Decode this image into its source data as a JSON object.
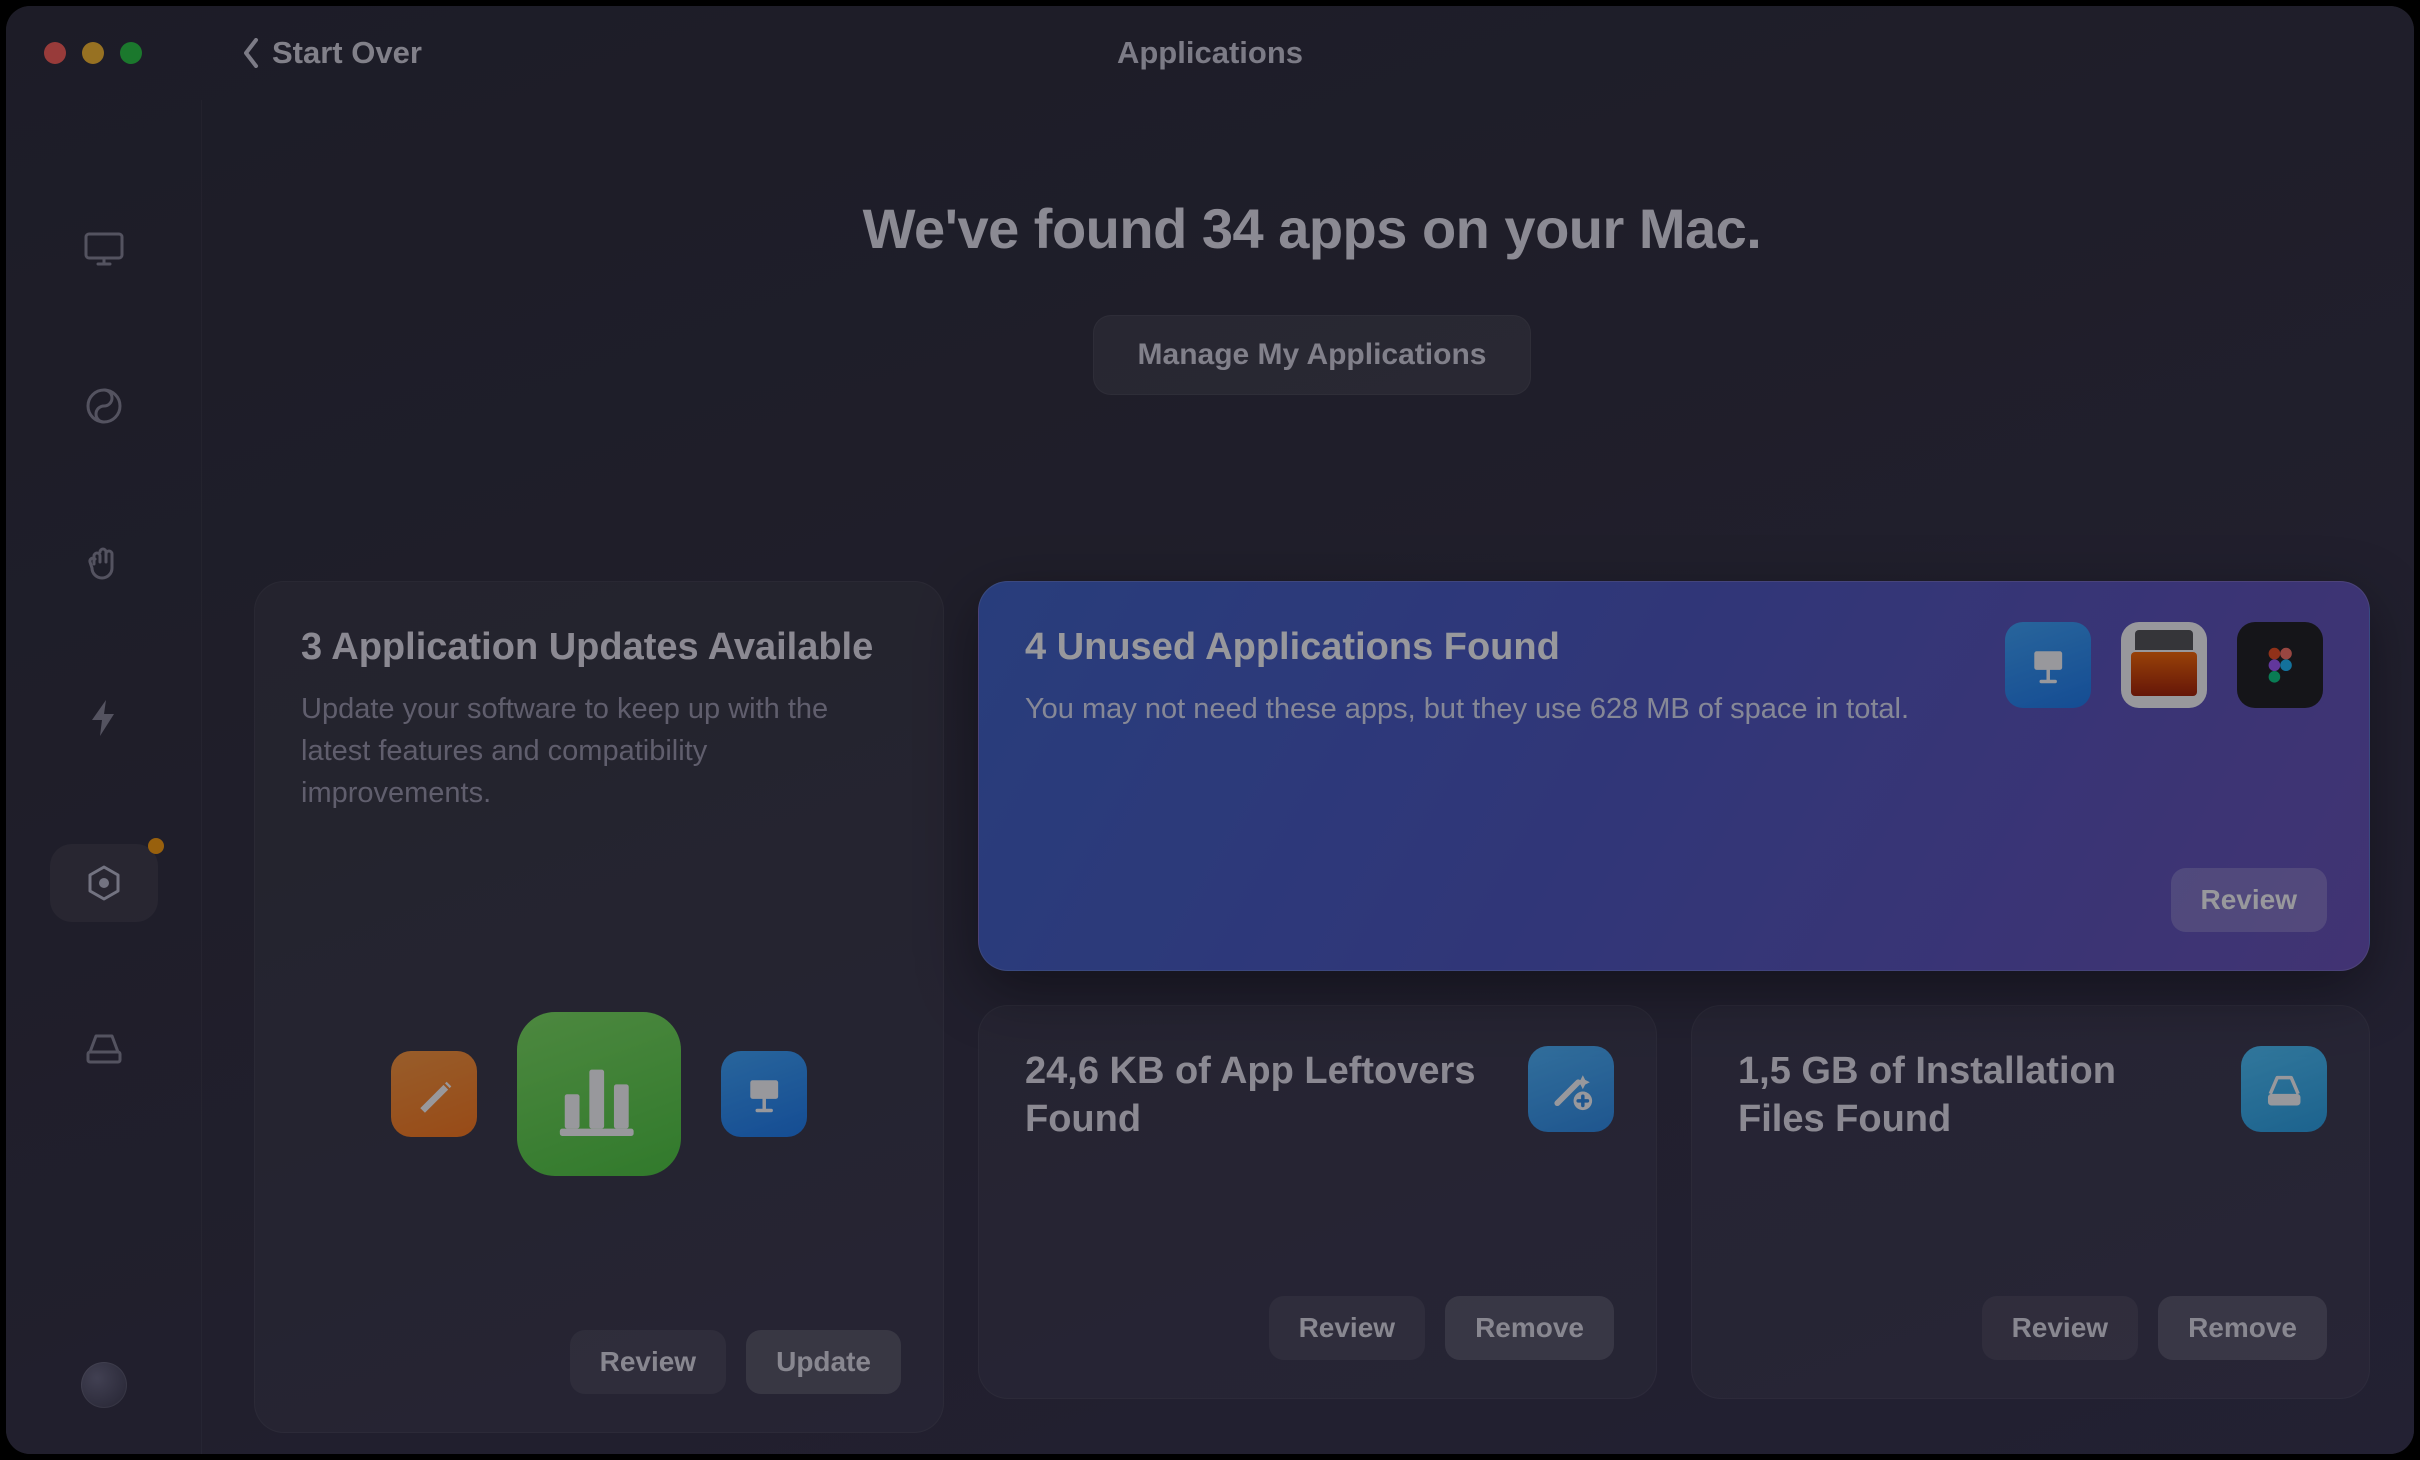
{
  "titlebar": {
    "back_label": "Start Over",
    "title": "Applications"
  },
  "sidebar": {
    "items": [
      {
        "name": "mac-overview-icon"
      },
      {
        "name": "junk-icon"
      },
      {
        "name": "privacy-icon"
      },
      {
        "name": "speed-icon"
      },
      {
        "name": "applications-icon"
      },
      {
        "name": "files-icon"
      }
    ],
    "active_index": 4
  },
  "hero": {
    "headline": "We've found 34 apps on your Mac.",
    "manage_label": "Manage My Applications"
  },
  "cards": {
    "updates": {
      "title": "3 Application Updates Available",
      "desc": "Update your software to keep up with the latest features and compatibility improvements.",
      "review_label": "Review",
      "update_label": "Update",
      "icons": [
        "pages",
        "numbers",
        "keynote"
      ]
    },
    "unused": {
      "title": "4 Unused Applications Found",
      "desc": "You may not need these apps, but they use 628 MB of space in total.",
      "review_label": "Review",
      "thumbs": [
        "keynote",
        "printer",
        "figma"
      ]
    },
    "leftovers": {
      "title": "24,6 KB of App Leftovers Found",
      "review_label": "Review",
      "remove_label": "Remove"
    },
    "installers": {
      "title": "1,5 GB of Installation Files Found",
      "review_label": "Review",
      "remove_label": "Remove"
    }
  }
}
